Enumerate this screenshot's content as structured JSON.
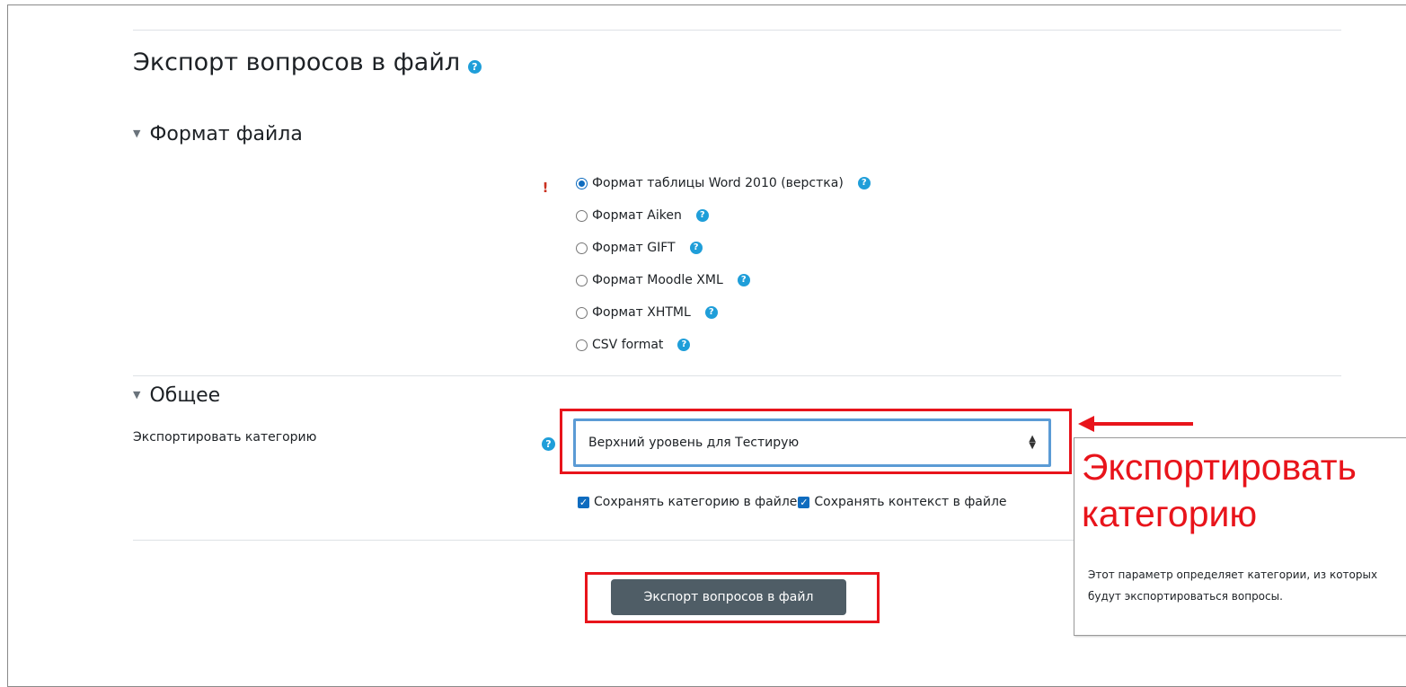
{
  "page": {
    "title": "Экспорт вопросов в файл"
  },
  "format_section": {
    "heading": "Формат файла",
    "options": [
      {
        "label": "Формат таблицы Word 2010 (верстка)",
        "checked": true
      },
      {
        "label": "Формат Aiken",
        "checked": false
      },
      {
        "label": "Формат GIFT",
        "checked": false
      },
      {
        "label": "Формат Moodle XML",
        "checked": false
      },
      {
        "label": "Формат XHTML",
        "checked": false
      },
      {
        "label": "CSV format",
        "checked": false
      }
    ]
  },
  "general_section": {
    "heading": "Общее",
    "category_label": "Экспортировать категорию",
    "category_value": "Верхний уровень для Тестирую",
    "save_category_label": "Сохранять категорию в файле",
    "save_context_label": "Сохранять контекст в файле"
  },
  "submit": {
    "label": "Экспорт вопросов в файл"
  },
  "callout": {
    "title": "Экспортировать категорию",
    "text": "Этот параметр определяет категории, из которых будут экспортироваться вопросы."
  },
  "icons": {
    "help": "question-circle-icon",
    "required": "exclamation-circle-icon",
    "collapse": "caret-down-icon",
    "select": "sort-arrows-icon",
    "check": "checkbox-checked-icon"
  },
  "colors": {
    "help": "#1f9ed9",
    "required": "#ca3120",
    "annotation": "#e8141b",
    "button": "#4f5d66",
    "select_focus": "#5b9bd5"
  }
}
